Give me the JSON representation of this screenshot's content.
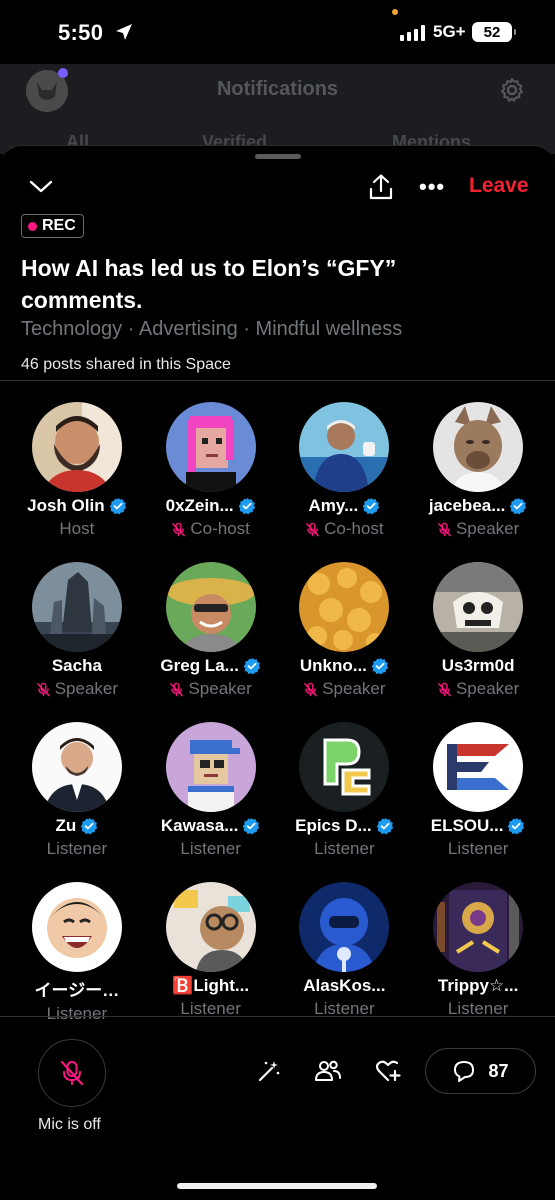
{
  "status_bar": {
    "time": "5:50",
    "network": "5G+",
    "battery": "52"
  },
  "background": {
    "title": "Notifications",
    "tabs": [
      "All",
      "Verified",
      "Mentions"
    ]
  },
  "space": {
    "leave_label": "Leave",
    "rec_label": "REC",
    "title": "How AI has led us to Elon’s “GFY” comments.",
    "topics": "Technology · Advertising · Mindful wellness",
    "posts_shared": "46 posts shared in this Space"
  },
  "participants": [
    {
      "name": "Josh Olin",
      "role": "Host",
      "verified": true,
      "muted": false,
      "avatar": "face-beard"
    },
    {
      "name": "0xZein...",
      "role": "Co-host",
      "verified": true,
      "muted": true,
      "avatar": "pixel-pink"
    },
    {
      "name": "Amy...",
      "role": "Co-host",
      "verified": true,
      "muted": true,
      "avatar": "photo-blue"
    },
    {
      "name": "jacebea...",
      "role": "Speaker",
      "verified": true,
      "muted": true,
      "avatar": "bear-mask"
    },
    {
      "name": "Sacha",
      "role": "Speaker",
      "verified": false,
      "muted": true,
      "avatar": "city-art"
    },
    {
      "name": "Greg La...",
      "role": "Speaker",
      "verified": true,
      "muted": true,
      "avatar": "straw-hat"
    },
    {
      "name": "Unkno...",
      "role": "Speaker",
      "verified": true,
      "muted": true,
      "avatar": "orange-cells"
    },
    {
      "name": "Us3rm0d",
      "role": "Speaker",
      "verified": false,
      "muted": true,
      "avatar": "skull-car"
    },
    {
      "name": "Zu",
      "role": "Listener",
      "verified": true,
      "muted": false,
      "avatar": "man-suit"
    },
    {
      "name": "Kawasa...",
      "role": "Listener",
      "verified": true,
      "muted": false,
      "avatar": "pixel-cap"
    },
    {
      "name": "Epics D...",
      "role": "Listener",
      "verified": true,
      "muted": false,
      "avatar": "logo-pe"
    },
    {
      "name": "ELSOU...",
      "role": "Listener",
      "verified": true,
      "muted": false,
      "avatar": "logo-e"
    },
    {
      "name": "イージー…",
      "role": "Listener",
      "verified": false,
      "muted": false,
      "avatar": "laughing-man"
    },
    {
      "name": "🅱️Light...",
      "role": "Listener",
      "verified": false,
      "muted": false,
      "avatar": "glasses-man"
    },
    {
      "name": "AlasKos...",
      "role": "Listener",
      "verified": false,
      "muted": false,
      "avatar": "blue-robot"
    },
    {
      "name": "Trippy☆...",
      "role": "Listener",
      "verified": false,
      "muted": false,
      "avatar": "pinball"
    }
  ],
  "bottom_bar": {
    "mic_label": "Mic is off",
    "comment_count": "87"
  },
  "colors": {
    "leave": "#f4212e",
    "verified": "#1d9bf0",
    "muted": "#f91880",
    "secondary_text": "#71767b"
  }
}
